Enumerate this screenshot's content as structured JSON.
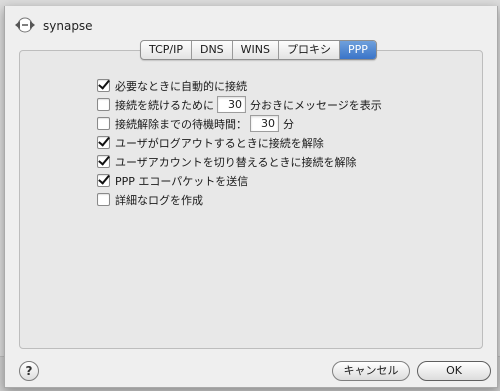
{
  "window": {
    "title": "synapse"
  },
  "tabs": [
    {
      "label": "TCP/IP",
      "active": false
    },
    {
      "label": "DNS",
      "active": false
    },
    {
      "label": "WINS",
      "active": false
    },
    {
      "label": "プロキシ",
      "active": false
    },
    {
      "label": "PPP",
      "active": true
    }
  ],
  "options": {
    "auto_connect": {
      "label": "必要なときに自動的に接続",
      "checked": true
    },
    "keepalive_prompt": {
      "label_before": "接続を続けるために",
      "value": "30",
      "label_after": "分おきにメッセージを表示",
      "checked": false
    },
    "idle_disconnect": {
      "label_before": "接続解除までの待機時間：",
      "value": "30",
      "label_after": "分",
      "checked": false
    },
    "disconnect_on_logout": {
      "label": "ユーザがログアウトするときに接続を解除",
      "checked": true
    },
    "disconnect_on_switch": {
      "label": "ユーザアカウントを切り替えるときに接続を解除",
      "checked": true
    },
    "ppp_echo": {
      "label": "PPP エコーパケットを送信",
      "checked": true
    },
    "verbose_log": {
      "label": "詳細なログを作成",
      "checked": false
    }
  },
  "footer": {
    "help_label": "?",
    "cancel_label": "キャンセル",
    "ok_label": "OK"
  },
  "icons": {
    "title_icon": "network-arrows-icon"
  }
}
